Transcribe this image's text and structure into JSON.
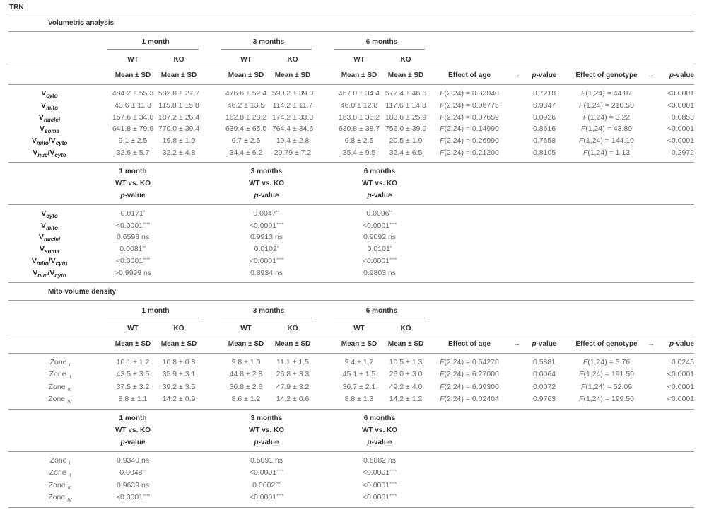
{
  "title": "TRN",
  "sections": [
    {
      "name": "Volumetric analysis",
      "groups": [
        "1 month",
        "3 months",
        "6 months"
      ],
      "genotypes": [
        "WT",
        "KO"
      ],
      "stat_label": "Mean ± SD",
      "effect_headers": {
        "age": "Effect of age",
        "arrow": "→",
        "pvalue": "p-value",
        "genotype": "Effect of genotype"
      },
      "rows": [
        {
          "label": "V",
          "sub": "cyto",
          "label2": "",
          "sub2": "",
          "values": [
            "484.2 ± 55.3",
            "582.8 ± 27.7",
            "476.6 ± 52.4",
            "590.2 ± 39.0",
            "467.0 ± 34.4",
            "572.4 ± 46.6"
          ],
          "age_f": "(2,24) = 0.33040",
          "age_p": "0.7218",
          "geno_f": "(1,24) = 44.07",
          "geno_p": "<0.0001"
        },
        {
          "label": "V",
          "sub": "mito",
          "label2": "",
          "sub2": "",
          "values": [
            "43.6 ± 11.3",
            "115.8 ± 15.8",
            "46.2 ± 13.5",
            "114.2 ± 11.7",
            "46.0 ± 12.8",
            "117.6 ± 14.3"
          ],
          "age_f": "(2,24) = 0.06775",
          "age_p": "0.9347",
          "geno_f": "(1,24) = 210.50",
          "geno_p": "<0.0001"
        },
        {
          "label": "V",
          "sub": "nuclei",
          "label2": "",
          "sub2": "",
          "values": [
            "157.6 ± 34.0",
            "187.2 ± 26.4",
            "162.8 ± 28.2",
            "174.2 ± 33.3",
            "163.8 ± 36.2",
            "183.6 ± 25.9"
          ],
          "age_f": "(2,24) = 0.07659",
          "age_p": "0.0926",
          "geno_f": "(1,24) = 3.22",
          "geno_p": "0.0853"
        },
        {
          "label": "V",
          "sub": "soma",
          "label2": "",
          "sub2": "",
          "values": [
            "641.8 ± 79.6",
            "770.0 ± 39.4",
            "639.4 ± 65.0",
            "764.4 ± 34.6",
            "630.8 ± 38.7",
            "756.0 ± 39.0"
          ],
          "age_f": "(2,24) = 0.14990",
          "age_p": "0.8616",
          "geno_f": "(1,24) = 43.89",
          "geno_p": "<0.0001"
        },
        {
          "label": "V",
          "sub": "mito",
          "label2": "/V",
          "sub2": "cyto",
          "values": [
            "9.1 ± 2.5",
            "19.8 ± 1.9",
            "9.7 ± 2.5",
            "19.4 ± 2.8",
            "9.8 ± 2.5",
            "20.5 ± 1.9"
          ],
          "age_f": "(2,24) = 0.26990",
          "age_p": "0.7658",
          "geno_f": "(1,24) = 144.10",
          "geno_p": "<0.0001"
        },
        {
          "label": "V",
          "sub": "nuc",
          "label2": "/V",
          "sub2": "cyto",
          "values": [
            "32.6 ± 5.7",
            "32.2 ± 4.8",
            "34.4 ± 6.2",
            "29.79 ± 7.2",
            "35.4 ± 9.5",
            "32.4 ± 6.5"
          ],
          "age_f": "(2,24) = 0.21200",
          "age_p": "0.8105",
          "geno_f": "(1,24) = 1.13",
          "geno_p": "0.2972"
        }
      ],
      "posthoc": {
        "headers": [
          {
            "group": "1 month",
            "compare": "WT vs. KO",
            "p": "-value"
          },
          {
            "group": "3 months",
            "compare": "WT vs. KO",
            "p": "-value"
          },
          {
            "group": "6 months",
            "compare": "WT vs. KO",
            "p": "-value"
          }
        ],
        "rows": [
          [
            {
              "v": "0.0171",
              "s": "*"
            },
            {
              "v": "0.0047",
              "s": "**"
            },
            {
              "v": "0.0096",
              "s": "**"
            }
          ],
          [
            {
              "v": "<0.0001",
              "s": "****"
            },
            {
              "v": "<0.0001",
              "s": "****"
            },
            {
              "v": "<0.0001",
              "s": "****"
            }
          ],
          [
            {
              "v": "0.6593 ns",
              "s": ""
            },
            {
              "v": "0.9913 ns",
              "s": ""
            },
            {
              "v": "0.9092 ns",
              "s": ""
            }
          ],
          [
            {
              "v": "0.0081",
              "s": "**"
            },
            {
              "v": "0.0102",
              "s": "*"
            },
            {
              "v": "0.0101",
              "s": "*"
            }
          ],
          [
            {
              "v": "<0.0001",
              "s": "****"
            },
            {
              "v": "<0.0001",
              "s": "****"
            },
            {
              "v": "<0.0001",
              "s": "****"
            }
          ],
          [
            {
              "v": ">0.9999 ns",
              "s": ""
            },
            {
              "v": "0.8934 ns",
              "s": ""
            },
            {
              "v": "0.9803 ns",
              "s": ""
            }
          ]
        ]
      }
    },
    {
      "name": "Mito volume density",
      "groups": [
        "1 month",
        "3 months",
        "6 months"
      ],
      "genotypes": [
        "WT",
        "KO"
      ],
      "stat_label": "Mean ± SD",
      "effect_headers": {
        "age": "Effect of age",
        "arrow": "→",
        "pvalue": "p-value",
        "genotype": "Effect of genotype"
      },
      "rows": [
        {
          "label": "Zone ",
          "sub": "I",
          "values": [
            "10.1 ± 1.2",
            "10.8 ± 0.8",
            "9.8 ± 1.0",
            "11.1 ± 1.5",
            "9.4 ± 1.2",
            "10.5 ± 1.3"
          ],
          "age_f": "(2,24) = 0.54270",
          "age_p": "0.5881",
          "geno_f": "(1,24) = 5.76",
          "geno_p": "0.0245"
        },
        {
          "label": "Zone ",
          "sub": "II",
          "values": [
            "43.5 ± 3.5",
            "35.9 ± 3.1",
            "44.8 ± 2.8",
            "26.8 ± 3.3",
            "45.1 ± 1.5",
            "26.0 ± 3.0"
          ],
          "age_f": "(2,24) = 6.27000",
          "age_p": "0.0064",
          "geno_f": "(1,24) = 191.50",
          "geno_p": "<0.0001"
        },
        {
          "label": "Zone ",
          "sub": "III",
          "values": [
            "37.5 ± 3.2",
            "39.2 ± 3.5",
            "36.8 ± 2.6",
            "47.9 ± 3.2",
            "36.7 ± 2.1",
            "49.2 ± 4.0"
          ],
          "age_f": "(2,24) = 6.09300",
          "age_p": "0.0072",
          "geno_f": "(1,24) = 52.09",
          "geno_p": "<0.0001"
        },
        {
          "label": "Zone ",
          "sub": "IV",
          "values": [
            "8.8 ± 1.1",
            "14.2 ± 0.9",
            "8.6 ± 1.2",
            "14.2 ± 0.6",
            "8.8 ± 1.3",
            "14.2 ± 1.2"
          ],
          "age_f": "(2,24) = 0.02404",
          "age_p": "0.9763",
          "geno_f": "(1,24) = 199.50",
          "geno_p": "<0.0001"
        }
      ],
      "posthoc": {
        "headers": [
          {
            "group": "1 month",
            "compare": "WT vs. KO",
            "p": "-value"
          },
          {
            "group": "3 months",
            "compare": "WT vs. KO",
            "p": "-value"
          },
          {
            "group": "6 months",
            "compare": "WT vs. KO",
            "p": "-value"
          }
        ],
        "rows": [
          [
            {
              "v": "0.9340 ns",
              "s": ""
            },
            {
              "v": "0.5091 ns",
              "s": ""
            },
            {
              "v": "0.6882 ns",
              "s": ""
            }
          ],
          [
            {
              "v": "0.0048",
              "s": "**"
            },
            {
              "v": "<0.0001",
              "s": "****"
            },
            {
              "v": "<0.0001",
              "s": "****"
            }
          ],
          [
            {
              "v": "0.9639 ns",
              "s": ""
            },
            {
              "v": "0.0002",
              "s": "***"
            },
            {
              "v": "<0.0001",
              "s": "****"
            }
          ],
          [
            {
              "v": "<0.0001",
              "s": "****"
            },
            {
              "v": "<0.0001",
              "s": "****"
            },
            {
              "v": "<0.0001",
              "s": "****"
            }
          ]
        ]
      }
    }
  ]
}
